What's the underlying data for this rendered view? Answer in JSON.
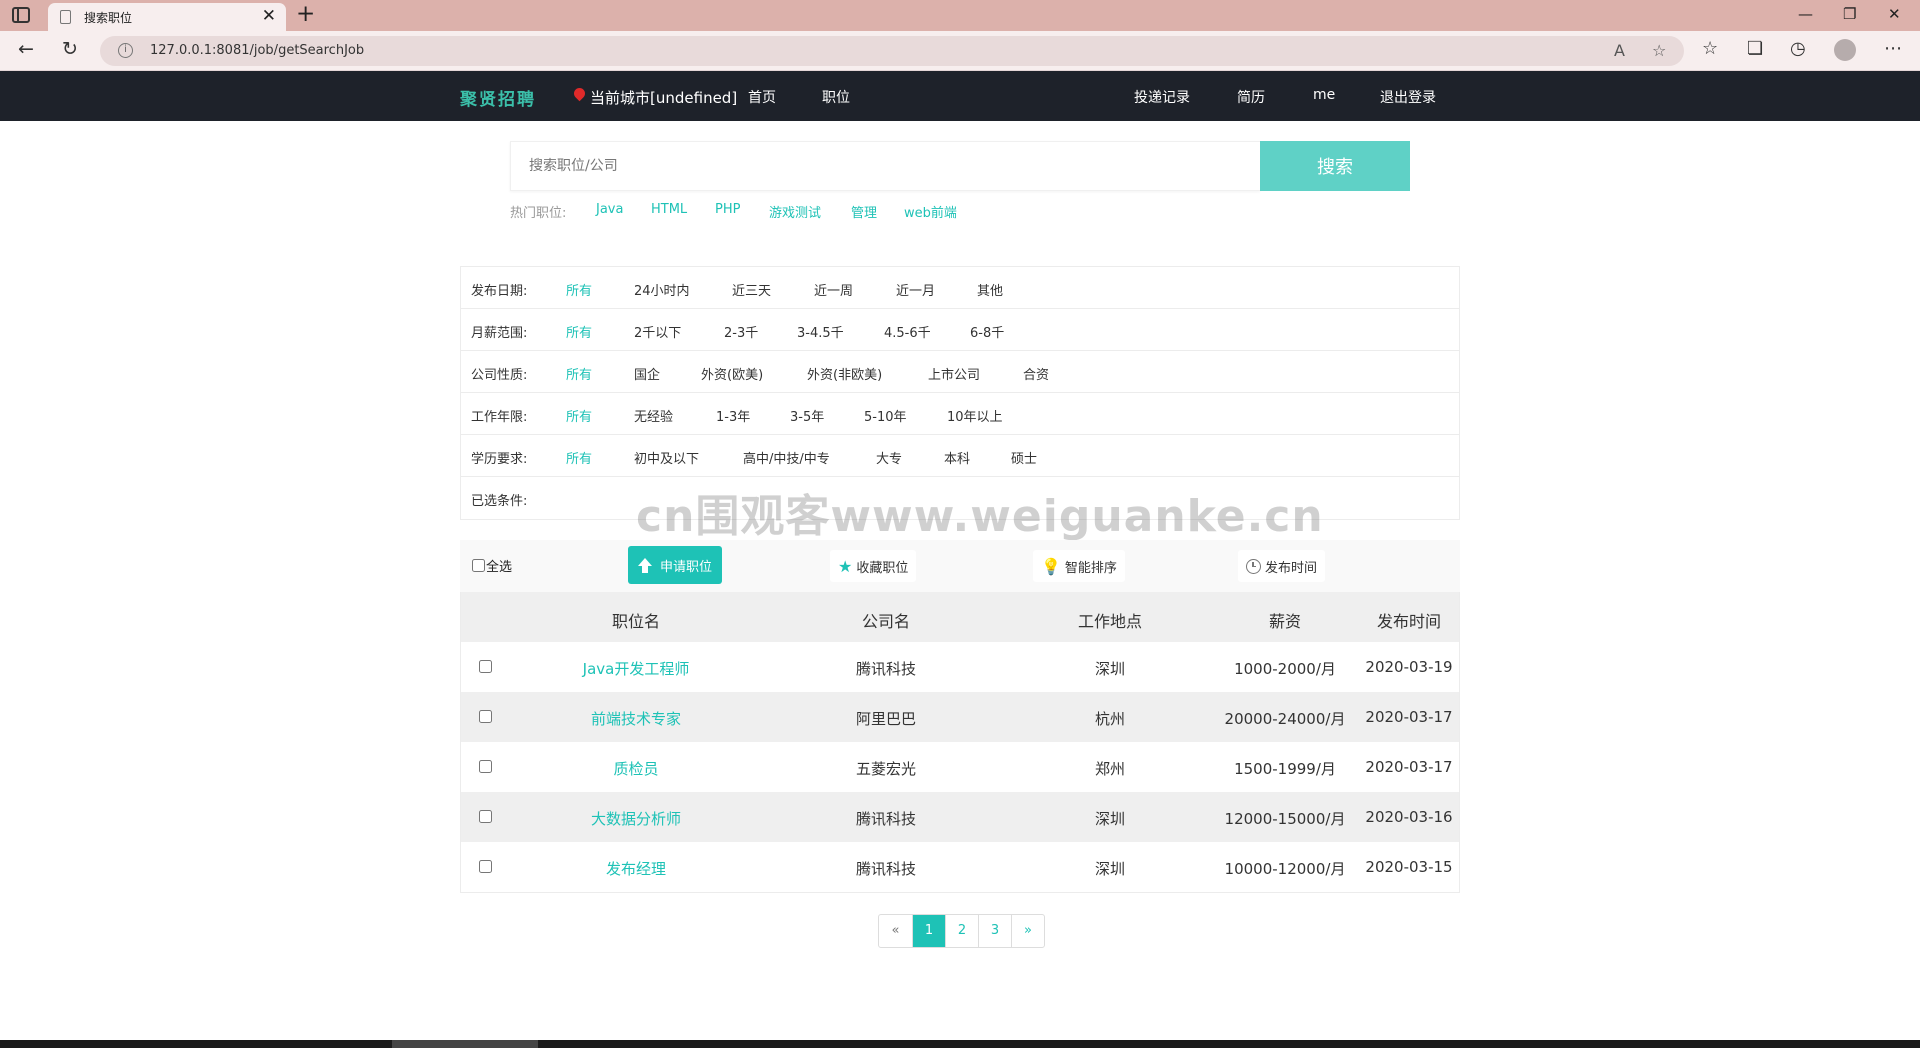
{
  "browser": {
    "tab_title": "搜索职位",
    "url": "127.0.0.1:8081/job/getSearchJob"
  },
  "header": {
    "logo": "聚贤招聘",
    "city": "当前城市[undefined]",
    "nav_home": "首页",
    "nav_jobs": "职位",
    "nav_records": "投递记录",
    "nav_resume": "简历",
    "nav_me": "me",
    "nav_logout": "退出登录"
  },
  "search": {
    "placeholder": "搜索职位/公司",
    "button": "搜索",
    "hot_label": "热门职位:",
    "hot": [
      "Java",
      "HTML",
      "PHP",
      "游戏测试",
      "管理",
      "web前端"
    ]
  },
  "filters": {
    "date": {
      "label": "发布日期:",
      "options": [
        "所有",
        "24小时内",
        "近三天",
        "近一周",
        "近一月",
        "其他"
      ]
    },
    "salary": {
      "label": "月薪范围:",
      "options": [
        "所有",
        "2千以下",
        "2-3千",
        "3-4.5千",
        "4.5-6千",
        "6-8千"
      ]
    },
    "company": {
      "label": "公司性质:",
      "options": [
        "所有",
        "国企",
        "外资(欧美)",
        "外资(非欧美)",
        "上市公司",
        "合资"
      ]
    },
    "experience": {
      "label": "工作年限:",
      "options": [
        "所有",
        "无经验",
        "1-3年",
        "3-5年",
        "5-10年",
        "10年以上"
      ]
    },
    "education": {
      "label": "学历要求:",
      "options": [
        "所有",
        "初中及以下",
        "高中/中技/中专",
        "大专",
        "本科",
        "硕士"
      ]
    },
    "selected": {
      "label": "已选条件:"
    }
  },
  "watermark": "cn围观客www.weiguanke.cn",
  "toolbar": {
    "select_all": "全选",
    "apply": "申请职位",
    "favorite": "收藏职位",
    "smart_sort": "智能排序",
    "publish_time": "发布时间"
  },
  "table": {
    "headers": [
      "职位名",
      "公司名",
      "工作地点",
      "薪资",
      "发布时间"
    ],
    "rows": [
      [
        "Java开发工程师",
        "腾讯科技",
        "深圳",
        "1000-2000/月",
        "2020-03-19"
      ],
      [
        "前端技术专家",
        "阿里巴巴",
        "杭州",
        "20000-24000/月",
        "2020-03-17"
      ],
      [
        "质检员",
        "五菱宏光",
        "郑州",
        "1500-1999/月",
        "2020-03-17"
      ],
      [
        "大数据分析师",
        "腾讯科技",
        "深圳",
        "12000-15000/月",
        "2020-03-16"
      ],
      [
        "发布经理",
        "腾讯科技",
        "深圳",
        "10000-12000/月",
        "2020-03-15"
      ]
    ]
  },
  "pagination": [
    "«",
    "1",
    "2",
    "3",
    "»"
  ]
}
